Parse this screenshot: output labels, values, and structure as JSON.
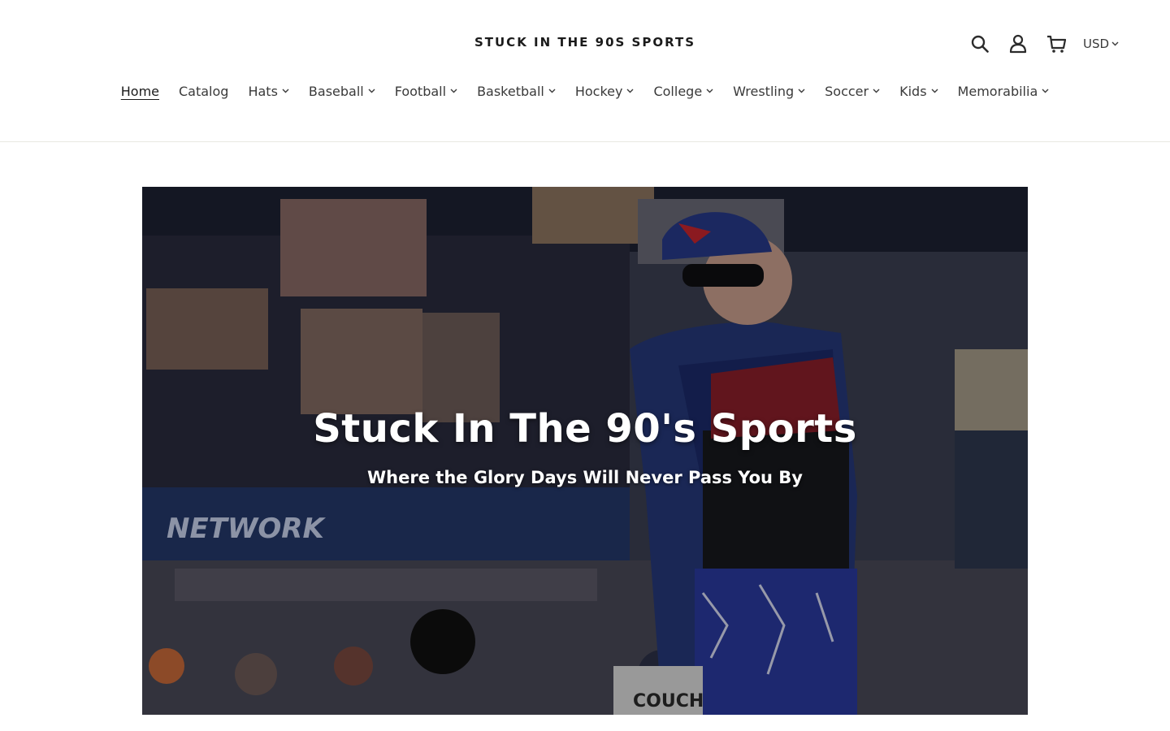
{
  "header": {
    "logo_text": "STUCK IN THE 90S SPORTS",
    "currency": "USD"
  },
  "nav": {
    "items": [
      {
        "label": "Home",
        "dropdown": false,
        "active": true
      },
      {
        "label": "Catalog",
        "dropdown": false
      },
      {
        "label": "Hats",
        "dropdown": true
      },
      {
        "label": "Baseball",
        "dropdown": true
      },
      {
        "label": "Football",
        "dropdown": true
      },
      {
        "label": "Basketball",
        "dropdown": true
      },
      {
        "label": "Hockey",
        "dropdown": true
      },
      {
        "label": "College",
        "dropdown": true
      },
      {
        "label": "Wrestling ",
        "dropdown": true
      },
      {
        "label": "Soccer",
        "dropdown": true
      },
      {
        "label": "Kids",
        "dropdown": true
      },
      {
        "label": "Memorabilia",
        "dropdown": true
      }
    ]
  },
  "hero": {
    "title": "Stuck In The 90's Sports",
    "subtitle": "Where the Glory Days Will Never Pass You By",
    "image_sign_text": "NETWORK",
    "image_jersey_text": "COUCH"
  },
  "icons": {
    "search": "search-icon",
    "account": "account-icon",
    "cart": "cart-icon",
    "dropdown": "chevron-down-icon"
  }
}
